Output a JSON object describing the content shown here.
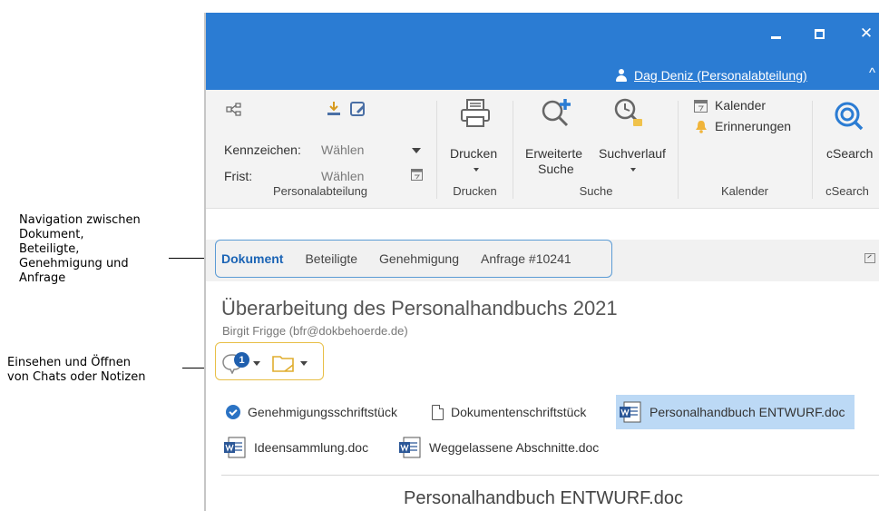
{
  "annotations": {
    "navigation": "Navigation zwischen\nDokument,\nBeteiligte,\nGenehmigung und\nAnfrage",
    "chats": "Einsehen und Öffnen\nvon Chats oder Notizen"
  },
  "window": {
    "minimize_glyph": "–",
    "close_glyph": "✕",
    "collapse_glyph": "^"
  },
  "user": {
    "name": "Dag Deniz (Personalabteilung)"
  },
  "ribbon": {
    "personalabteilung": {
      "label": "Personalabteilung",
      "kennzeichen_label": "Kennzeichen:",
      "kennzeichen_value": "Wählen",
      "frist_label": "Frist:",
      "frist_value": "Wählen"
    },
    "drucken": {
      "label": "Drucken",
      "button_label": "Drucken"
    },
    "suche": {
      "label": "Suche",
      "erweiterte_label_1": "Erweiterte",
      "erweiterte_label_2": "Suche",
      "suchverlauf_label": "Suchverlauf"
    },
    "kalender": {
      "label": "Kalender",
      "kalender_item": "Kalender",
      "erinnerungen_item": "Erinnerungen"
    },
    "csearch": {
      "label": "cSearch",
      "button_label": "cSearch"
    }
  },
  "tabs": [
    {
      "label": "Dokument",
      "active": true
    },
    {
      "label": "Beteiligte",
      "active": false
    },
    {
      "label": "Genehmigung",
      "active": false
    },
    {
      "label": "Anfrage #10241",
      "active": false
    }
  ],
  "document": {
    "title": "Überarbeitung des Personalhandbuchs 2021",
    "author": "Birgit Frigge (bfr@dokbehoerde.de)",
    "chat_badge": "1"
  },
  "attachments": [
    {
      "label": "Genehmigungsschriftstück",
      "icon": "check-circle-icon"
    },
    {
      "label": "Dokumentenschriftstück",
      "icon": "document-icon"
    },
    {
      "label": "Personalhandbuch ENTWURF.doc",
      "icon": "word-doc-icon",
      "selected": true
    },
    {
      "label": "Ideensammlung.doc",
      "icon": "word-doc-icon"
    },
    {
      "label": "Weggelassene Abschnitte.doc",
      "icon": "word-doc-icon"
    }
  ],
  "preview": {
    "title": "Personalhandbuch ENTWURF.doc"
  },
  "colors": {
    "titlebar": "#2b7cd3",
    "ribbon_bg": "#f3f3f3",
    "nav_highlight": "#5b9bd5",
    "chat_highlight": "#e8bf47",
    "selected_attachment": "#bcd9f5",
    "accent": "#1b64b5"
  }
}
